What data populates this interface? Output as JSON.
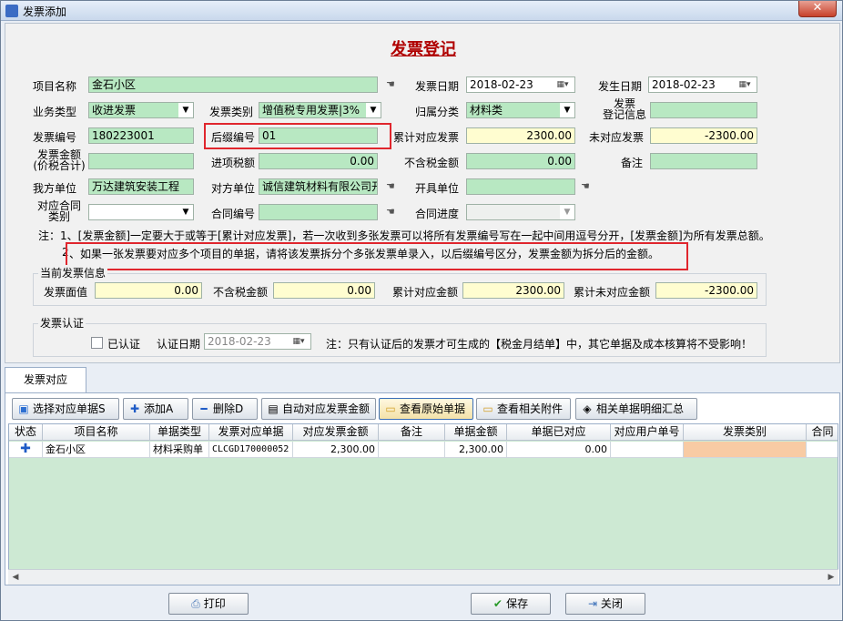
{
  "window": {
    "title": "发票添加",
    "close": "✕"
  },
  "form": {
    "title": "发票登记",
    "project_name_label": "项目名称",
    "project_name": "金石小区",
    "invoice_date_label": "发票日期",
    "invoice_date": "2018-02-23",
    "occur_date_label": "发生日期",
    "occur_date": "2018-02-23",
    "business_type_label": "业务类型",
    "business_type": "收进发票",
    "invoice_type_label": "发票类别",
    "invoice_type": "增值税专用发票|3%",
    "category_label": "归属分类",
    "category": "材料类",
    "register_info_label": "发票\n登记信息",
    "register_info": "",
    "invoice_no_label": "发票编号",
    "invoice_no": "180223001",
    "suffix_no_label": "后缀编号",
    "suffix_no": "01",
    "cum_invoice_label": "累计对应发票",
    "cum_invoice": "2300.00",
    "uncorresponded_label": "未对应发票",
    "uncorresponded": "-2300.00",
    "invoice_amount_label": "发票金额\n(价税合计)",
    "invoice_amount": "",
    "input_tax_label": "进项税额",
    "input_tax": "0.00",
    "ex_tax_label": "不含税金额",
    "ex_tax": "0.00",
    "remark_label": "备注",
    "remark": "",
    "our_unit_label": "我方单位",
    "our_unit": "万达建筑安装工程",
    "counter_unit_label": "对方单位",
    "counter_unit": "诚信建筑材料有限公司开",
    "issuer_label": "开具单位",
    "issuer": "",
    "contract_type_label": "对应合同\n类别",
    "contract_type": "",
    "contract_no_label": "合同编号",
    "contract_no": "",
    "contract_progress_label": "合同进度",
    "contract_progress": ""
  },
  "notes": {
    "line1": "注：1、[发票金额]一定要大于或等于[累计对应发票]，若一次收到多张发票可以将所有发票编号写在一起中间用逗号分开，[发票金额]为所有发票总额。",
    "line2_prefix": "2",
    "line2": "、如果一张发票要对应多个项目的单据，请将该发票拆分个多张发票单录入，以后缀编号区分，发票金额为拆分后的金额。"
  },
  "current": {
    "title": "当前发票信息",
    "face_label": "发票面值",
    "face": "0.00",
    "ex_tax_label": "不含税金额",
    "ex_tax": "0.00",
    "cum_label": "累计对应金额",
    "cum": "2300.00",
    "uncum_label": "累计未对应金额",
    "uncum": "-2300.00"
  },
  "auth": {
    "title": "发票认证",
    "checked_label": "已认证",
    "date_label": "认证日期",
    "date": "2018-02-23",
    "note": "注：只有认证后的发票才可生成的【税金月结单】中，其它单据及成本核算将不受影响！"
  },
  "tabs": [
    {
      "label": "发票对应"
    }
  ],
  "toolbar": [
    {
      "label": "选择对应单据S",
      "icon": "select-doc-icon"
    },
    {
      "label": "添加A",
      "icon": "plus-icon"
    },
    {
      "label": "删除D",
      "icon": "minus-icon"
    },
    {
      "label": "自动对应发票金额",
      "icon": "calculator-icon"
    },
    {
      "label": "查看原始单据",
      "icon": "folder-icon"
    },
    {
      "label": "查看相关附件",
      "icon": "folder-icon"
    },
    {
      "label": "相关单据明细汇总",
      "icon": "summary-icon"
    }
  ],
  "grid": {
    "columns": [
      "状态",
      "项目名称",
      "单据类型",
      "发票对应单据",
      "对应发票金额",
      "备注",
      "单据金额",
      "单据已对应",
      "对应用户单号",
      "发票类别",
      "合同"
    ],
    "rows": [
      [
        "",
        "金石小区",
        "材料采购单",
        "CLCGD170000052",
        "2,300.00",
        "",
        "2,300.00",
        "0.00",
        "",
        "",
        ""
      ]
    ]
  },
  "footer": {
    "print": "打印",
    "save": "保存",
    "close": "关闭"
  }
}
